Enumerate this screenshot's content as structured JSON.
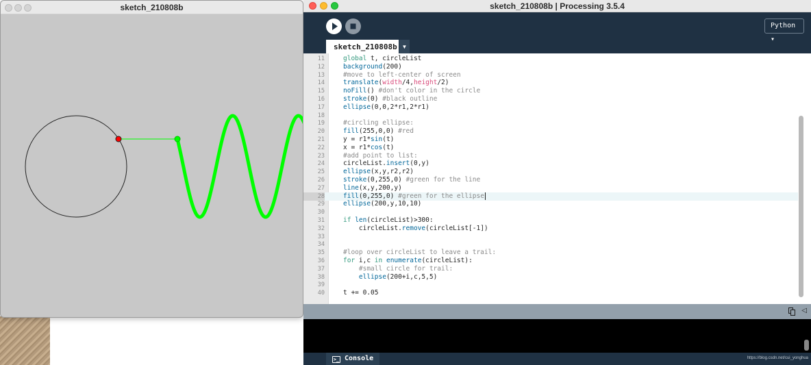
{
  "sketch_window": {
    "title": "sketch_210808b"
  },
  "ide_window": {
    "title": "sketch_210808b | Processing 3.5.4",
    "mode": "Python ▾",
    "tab_label": "sketch_210808b",
    "tab_menu_icon": "triangle-down-icon",
    "console_label": "Console",
    "watermark": "https://blog.csdn.net/cui_yonghua"
  },
  "icons": {
    "run": "play-icon",
    "stop": "stop-icon",
    "copy": "copy-icon",
    "collapse": "collapse-arrow-icon",
    "console": "console-icon"
  },
  "colors": {
    "ide_background": "#1f3143",
    "sine_wave": "#00ff00",
    "circle_point": "#ff0000",
    "canvas_background": "#c8c8c8"
  },
  "editor": {
    "current_line": 28,
    "lines": [
      {
        "num": "11",
        "code": "global t, circleList"
      },
      {
        "num": "12",
        "code": "background(200)"
      },
      {
        "num": "13",
        "code": "#move to left-center of screen"
      },
      {
        "num": "14",
        "code": "translate(width/4,height/2)"
      },
      {
        "num": "15",
        "code": "noFill() #don't color in the circle"
      },
      {
        "num": "16",
        "code": "stroke(0) #black outline"
      },
      {
        "num": "17",
        "code": "ellipse(0,0,2*r1,2*r1)"
      },
      {
        "num": "18",
        "code": ""
      },
      {
        "num": "19",
        "code": "#circling ellipse:"
      },
      {
        "num": "20",
        "code": "fill(255,0,0) #red"
      },
      {
        "num": "21",
        "code": "y = r1*sin(t)"
      },
      {
        "num": "22",
        "code": "x = r1*cos(t)"
      },
      {
        "num": "23",
        "code": "#add point to list:"
      },
      {
        "num": "24",
        "code": "circleList.insert(0,y)"
      },
      {
        "num": "25",
        "code": "ellipse(x,y,r2,r2)"
      },
      {
        "num": "26",
        "code": "stroke(0,255,0) #green for the line"
      },
      {
        "num": "27",
        "code": "line(x,y,200,y)"
      },
      {
        "num": "28",
        "code": "fill(0,255,0) #green for the ellipse"
      },
      {
        "num": "29",
        "code": "ellipse(200,y,10,10)"
      },
      {
        "num": "30",
        "code": ""
      },
      {
        "num": "31",
        "code": "if len(circleList)>300:"
      },
      {
        "num": "32",
        "code": "    circleList.remove(circleList[-1])"
      },
      {
        "num": "33",
        "code": ""
      },
      {
        "num": "34",
        "code": ""
      },
      {
        "num": "35",
        "code": "#loop over circleList to leave a trail:"
      },
      {
        "num": "36",
        "code": "for i,c in enumerate(circleList):"
      },
      {
        "num": "37",
        "code": "    #small circle for trail:"
      },
      {
        "num": "38",
        "code": "    ellipse(200+i,c,5,5)"
      },
      {
        "num": "39",
        "code": ""
      },
      {
        "num": "40",
        "code": "t += 0.05"
      }
    ]
  }
}
